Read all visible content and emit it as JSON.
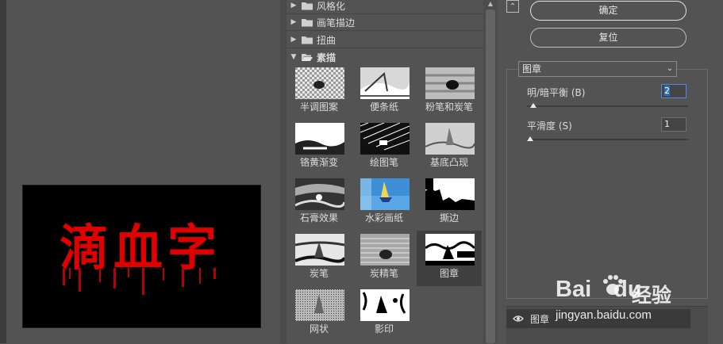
{
  "preview": {
    "text": "滴血字",
    "text_color": "#e00000",
    "background": "#000000"
  },
  "categories": [
    {
      "label": "风格化",
      "open": false
    },
    {
      "label": "画笔描边",
      "open": false
    },
    {
      "label": "扭曲",
      "open": false
    },
    {
      "label": "素描",
      "open": true
    }
  ],
  "sketch_filters": [
    {
      "label": "半调图案",
      "icon": "halftone-pattern-thumbnail"
    },
    {
      "label": "便条纸",
      "icon": "note-paper-thumbnail"
    },
    {
      "label": "粉笔和炭笔",
      "icon": "chalk-charcoal-thumbnail"
    },
    {
      "label": "铬黄渐变",
      "icon": "chrome-thumbnail"
    },
    {
      "label": "绘图笔",
      "icon": "graphic-pen-thumbnail"
    },
    {
      "label": "基底凸现",
      "icon": "bas-relief-thumbnail"
    },
    {
      "label": "石膏效果",
      "icon": "plaster-thumbnail"
    },
    {
      "label": "水彩画纸",
      "icon": "water-paper-thumbnail"
    },
    {
      "label": "撕边",
      "icon": "torn-edges-thumbnail"
    },
    {
      "label": "炭笔",
      "icon": "charcoal-thumbnail"
    },
    {
      "label": "炭精笔",
      "icon": "conte-crayon-thumbnail"
    },
    {
      "label": "图章",
      "icon": "stamp-thumbnail",
      "selected": true
    },
    {
      "label": "网状",
      "icon": "reticulation-thumbnail"
    },
    {
      "label": "影印",
      "icon": "photocopy-thumbnail"
    }
  ],
  "buttons": {
    "ok": "确定",
    "reset": "复位"
  },
  "settings": {
    "selected_filter": "图章",
    "params": [
      {
        "label": "明/暗平衡 (B)",
        "value": "2",
        "level": 2,
        "max": 50
      },
      {
        "label": "平滑度 (S)",
        "value": "1",
        "level": 1,
        "max": 50
      }
    ]
  },
  "layers": [
    {
      "name": "图章",
      "visible": true
    }
  ],
  "watermark": {
    "brand": "Bai",
    "brand2": "du",
    "product": "经验",
    "url": "jingyan.baidu.com"
  },
  "colors": {
    "panel": "#535353",
    "accent_focus": "#4a90d9"
  }
}
